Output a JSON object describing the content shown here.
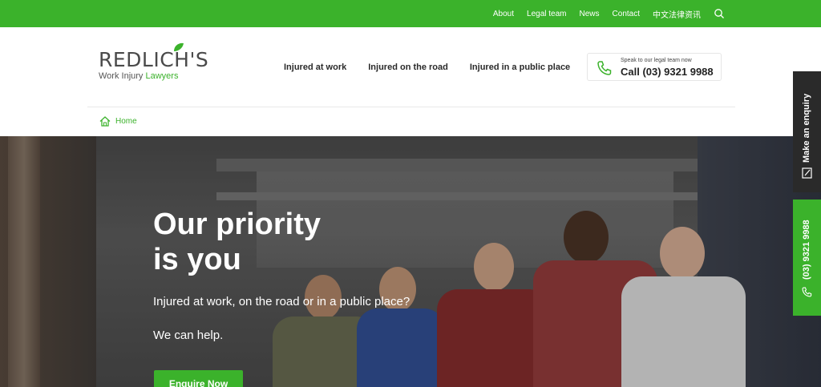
{
  "topnav": {
    "items": [
      "About",
      "Legal team",
      "News",
      "Contact",
      "中文法律资讯"
    ],
    "search_icon": "search-icon"
  },
  "logo": {
    "main": "REDLICH'S",
    "sub_plain": "Work Injury",
    "sub_green": "Lawyers"
  },
  "mainnav": {
    "items": [
      "Injured at work",
      "Injured on the road",
      "Injured in a public place"
    ]
  },
  "call": {
    "small": "Speak to our legal team now",
    "big": "Call (03) 9321 9988",
    "icon": "phone-icon"
  },
  "breadcrumb": {
    "home": "Home",
    "icon": "home-icon"
  },
  "hero": {
    "title_line1": "Our priority",
    "title_line2": "is you",
    "text1": "Injured at work, on the road or in a public place?",
    "text2": "We can help.",
    "button": "Enquire Now"
  },
  "sidetabs": {
    "enquiry": "Make an enquiry",
    "phone": "(03) 9321 9988"
  },
  "colors": {
    "brand_green": "#3bb22b",
    "dark_tab": "#2a2a2a"
  }
}
